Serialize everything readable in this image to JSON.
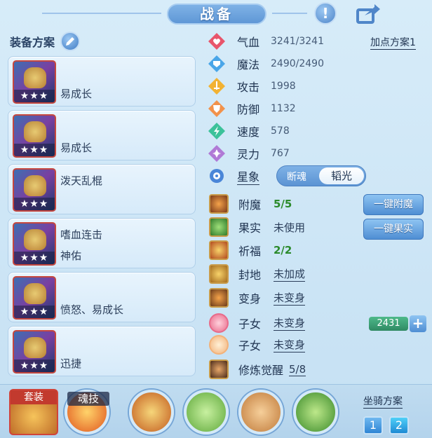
{
  "title": "战备",
  "left": {
    "header": "装备方案",
    "plans": [
      {
        "text1": "",
        "text2": "易成长",
        "stars": "★★★"
      },
      {
        "text1": "",
        "text2": "易成长",
        "stars": "★★★"
      },
      {
        "text1": "泼天乱棍",
        "text2": "",
        "stars": "★★★"
      },
      {
        "text1": "嗜血连击",
        "text2": "神佑",
        "stars": "★★★"
      },
      {
        "text1": "",
        "text2": "愤怒、易成长",
        "stars": "★★★"
      },
      {
        "text1": "",
        "text2": "迅捷",
        "stars": "★★★"
      }
    ]
  },
  "add_point_label": "加点方案1",
  "stats": [
    {
      "icon": "heart-icon",
      "color": "#e8556b",
      "label": "气血",
      "value": "3241/3241"
    },
    {
      "icon": "shield-mana-icon",
      "color": "#4aa6e8",
      "label": "魔法",
      "value": "2490/2490"
    },
    {
      "icon": "sword-icon",
      "color": "#f2b233",
      "label": "攻击",
      "value": "1998"
    },
    {
      "icon": "armor-icon",
      "color": "#f2924b",
      "label": "防御",
      "value": "1132"
    },
    {
      "icon": "lightning-icon",
      "color": "#3cc29a",
      "label": "速度",
      "value": "578"
    },
    {
      "icon": "spirit-icon",
      "color": "#b07ad6",
      "label": "灵力",
      "value": "767"
    }
  ],
  "xingxiang": {
    "label": "星象",
    "option_left": "断魂",
    "option_right": "韬光"
  },
  "status": [
    {
      "label": "附魔",
      "value": "5/5",
      "style": "green",
      "icon": "enchant-icon"
    },
    {
      "label": "果实",
      "value": "未使用",
      "style": "plain",
      "icon": "fruit-icon"
    },
    {
      "label": "祈福",
      "value": "2/2",
      "style": "green",
      "icon": "blessing-icon"
    },
    {
      "label": "封地",
      "value": "未加成",
      "style": "underline",
      "icon": "territory-icon"
    },
    {
      "label": "变身",
      "value": "未变身",
      "style": "underline",
      "icon": "transform-icon"
    },
    {
      "label": "子女",
      "value": "未变身",
      "style": "underline",
      "icon": "child-icon"
    },
    {
      "label": "子女",
      "value": "未变身",
      "style": "underline",
      "icon": "child-icon"
    },
    {
      "label": "修炼觉醒",
      "value": "5/8",
      "style": "underline",
      "icon": "cultivation-icon"
    }
  ],
  "buttons": {
    "enchant": "一键附魔",
    "fruit": "一键果实"
  },
  "child_hp": "2431",
  "bottom": {
    "suit_label": "套装",
    "soul_skill_label": "魂技",
    "mount_title": "坐骑方案",
    "mount_1": "1",
    "mount_2": "2"
  }
}
